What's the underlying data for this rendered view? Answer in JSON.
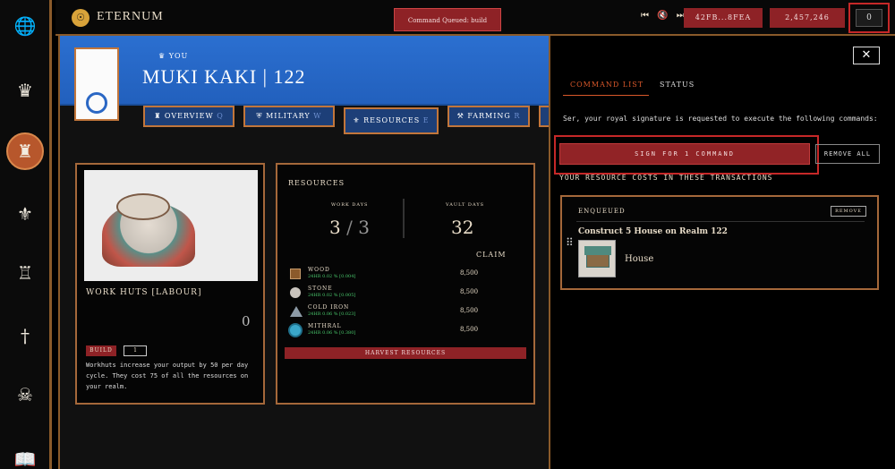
{
  "app": {
    "brand": "ETERNUM"
  },
  "sidebar": {
    "items": [
      {
        "icon": "globe-icon",
        "glyph": "🌐"
      },
      {
        "icon": "crown-icon",
        "glyph": "♛"
      },
      {
        "icon": "castle-icon",
        "glyph": "♜"
      },
      {
        "icon": "lords-icon",
        "glyph": "⚜"
      },
      {
        "icon": "tower-icon",
        "glyph": "♖"
      },
      {
        "icon": "sword-icon",
        "glyph": "†"
      },
      {
        "icon": "skull-icon",
        "glyph": "☠"
      },
      {
        "icon": "book-icon",
        "glyph": "📖"
      }
    ]
  },
  "topbar": {
    "queued": "Command Queued: build",
    "media": "⏮ 🔇 ⏭",
    "wallet": "42FB...8FEA",
    "lords": "2,457,246",
    "cmd_count": "0"
  },
  "realm": {
    "you": "YOU",
    "name": "MUKI KAKI | 122",
    "tabs": [
      {
        "label": "OVERVIEW",
        "key": "Q"
      },
      {
        "label": "MILITARY",
        "key": "W"
      },
      {
        "label": "RESOURCES",
        "key": "E"
      },
      {
        "label": "FARMING",
        "key": "R"
      }
    ]
  },
  "building": {
    "title": "WORK HUTS [LABOUR]",
    "count": "0",
    "build_label": "BUILD",
    "qty": "1",
    "description": "Workhuts increase your output by 50 per day cycle. They cost 75 of all the resources on your realm."
  },
  "resources": {
    "heading": "RESOURCES",
    "work_days_label": "WORK DAYS",
    "work_days_value": "3",
    "work_days_total": "3",
    "vault_days_label": "VAULT DAYS",
    "vault_days_value": "32",
    "claim_label": "CLAIM",
    "rows": [
      {
        "name": "WOOD",
        "rate": "24HR 0.02 % [0.004]",
        "value": "8,500",
        "color": "#8b5a2b"
      },
      {
        "name": "STONE",
        "rate": "24HR 0.02 % [0.005]",
        "value": "8,500",
        "color": "#c9c4bd"
      },
      {
        "name": "COLD IRON",
        "rate": "24HR 0.06 % [0.023]",
        "value": "8,500",
        "color": "#8c9aa6"
      },
      {
        "name": "MITHRAL",
        "rate": "24HR 0.06 % [0.380]",
        "value": "8,500",
        "color": "#3aa7c9"
      }
    ],
    "harvest_label": "HARVEST RESOURCES"
  },
  "panel": {
    "tab_command_list": "COMMAND LIST",
    "tab_status": "STATUS",
    "message": "Ser, your royal signature is requested to execute the following commands:",
    "sign_label": "SIGN FOR 1 COMMAND",
    "remove_all_label": "REMOVE ALL",
    "costs_heading": "YOUR RESOURCE COSTS IN THESE TRANSACTIONS",
    "enqueued_label": "ENQUEUED",
    "remove_label": "REMOVE",
    "command_title": "Construct 5 House on Realm 122",
    "command_item": "House"
  }
}
